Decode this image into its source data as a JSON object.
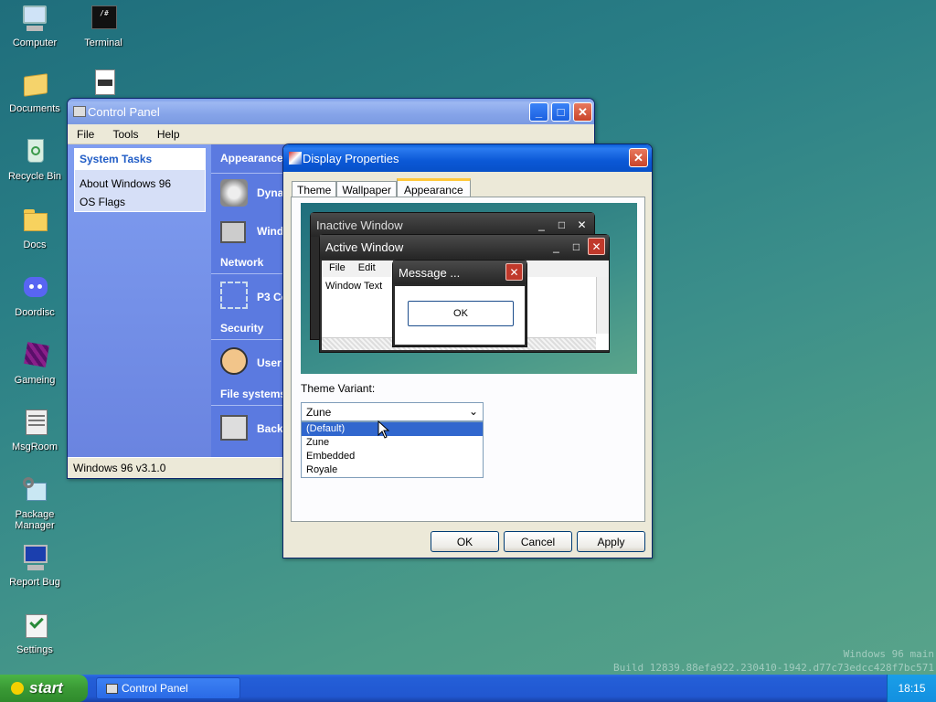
{
  "desktop": {
    "icons": [
      {
        "label": "Computer"
      },
      {
        "label": "Terminal"
      },
      {
        "label": "Documents"
      },
      {
        "label": "Recycle Bin"
      },
      {
        "label": "Docs"
      },
      {
        "label": "Doordisc"
      },
      {
        "label": "Gameing"
      },
      {
        "label": "MsgRoom"
      },
      {
        "label": "Package Manager"
      },
      {
        "label": "Report Bug"
      },
      {
        "label": "Settings"
      }
    ],
    "watermark_line1": "Windows 96 main",
    "watermark_line2": "Build 12839.88efa922.230410-1942.d77c73edcc428f7bc571"
  },
  "control_panel": {
    "title": "Control Panel",
    "menu": [
      "File",
      "Tools",
      "Help"
    ],
    "tasks_title": "System Tasks",
    "tasks": [
      "About Windows 96",
      "OS Flags"
    ],
    "sections": [
      {
        "heading": "Appearance",
        "item": "Dynamic"
      },
      {
        "heading": "",
        "item": "Windows"
      },
      {
        "heading": "Network",
        "item": "P3 Config"
      },
      {
        "heading": "Security",
        "item": "User Manager"
      },
      {
        "heading": "File systems",
        "item": "Backup"
      }
    ],
    "status": "Windows 96 v3.1.0"
  },
  "display_properties": {
    "title": "Display Properties",
    "tabs": [
      "Theme",
      "Wallpaper",
      "Appearance"
    ],
    "active_tab": "Appearance",
    "preview": {
      "inactive_title": "Inactive Window",
      "active_title": "Active Window",
      "menu": [
        "File",
        "Edit"
      ],
      "window_text": "Window Text",
      "message_title": "Message ...",
      "message_ok": "OK"
    },
    "variant_label": "Theme Variant:",
    "variant_selected": "Zune",
    "variant_options": [
      "(Default)",
      "Zune",
      "Embedded",
      "Royale"
    ],
    "highlighted_option": "(Default)",
    "buttons": {
      "ok": "OK",
      "cancel": "Cancel",
      "apply": "Apply"
    }
  },
  "taskbar": {
    "start": "start",
    "task": "Control Panel",
    "clock": "18:15"
  }
}
